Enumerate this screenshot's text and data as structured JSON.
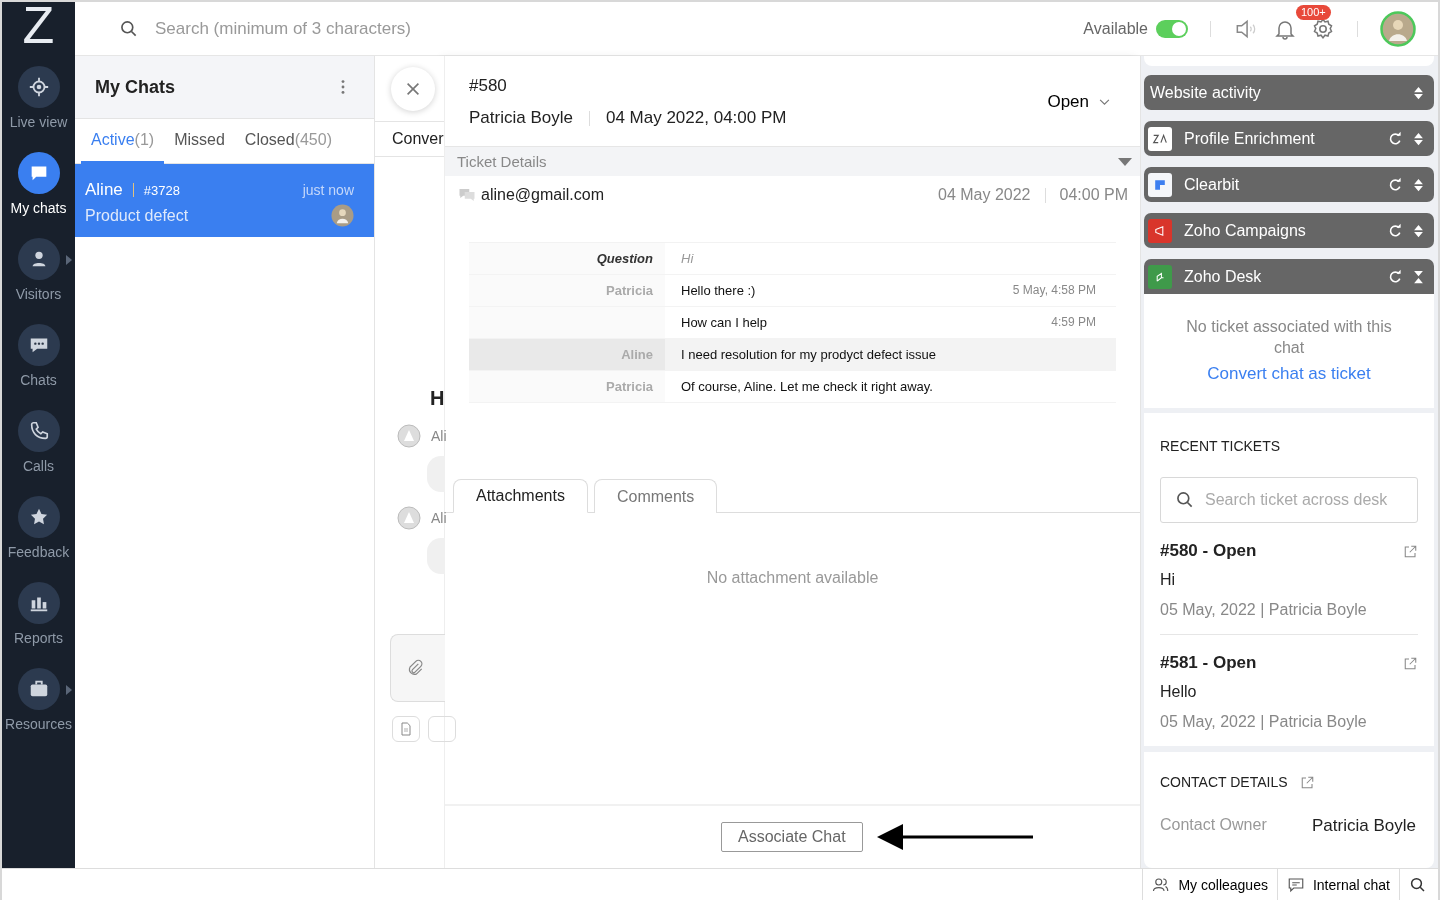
{
  "logo": "Z",
  "nav": [
    {
      "label": "Live view",
      "selected": false,
      "submenu": false
    },
    {
      "label": "My chats",
      "selected": true,
      "submenu": false
    },
    {
      "label": "Visitors",
      "selected": false,
      "submenu": true
    },
    {
      "label": "Chats",
      "selected": false,
      "submenu": false
    },
    {
      "label": "Calls",
      "selected": false,
      "submenu": false
    },
    {
      "label": "Feedback",
      "selected": false,
      "submenu": false
    },
    {
      "label": "Reports",
      "selected": false,
      "submenu": false
    },
    {
      "label": "Resources",
      "selected": false,
      "submenu": true
    }
  ],
  "search": {
    "placeholder": "Search (minimum of 3 characters)"
  },
  "status": {
    "label": "Available",
    "on": true
  },
  "notifications": {
    "badge": "100+"
  },
  "chat_list": {
    "title": "My Chats",
    "tabs": [
      {
        "label": "Active",
        "count": "(1)",
        "selected": true
      },
      {
        "label": "Missed",
        "selected": false
      },
      {
        "label": "Closed",
        "count": "(450)",
        "selected": false
      }
    ],
    "chats": [
      {
        "name": "Aline",
        "id": "#3728",
        "time": "just now",
        "subject": "Product defect",
        "selected": true
      }
    ]
  },
  "conversation": {
    "tab": "Conver",
    "heading": "H",
    "senders": [
      "Ali",
      "Ali"
    ]
  },
  "ticket": {
    "number": "#580",
    "contact": "Patricia Boyle",
    "datetime": "04 May 2022, 04:00 PM",
    "status": "Open",
    "section": "Ticket Details",
    "expanded": true,
    "email": "aline@gmail.com",
    "date": "04 May 2022",
    "time": "04:00 PM",
    "thread": [
      {
        "kind": "question",
        "label": "Question",
        "text": "Hi",
        "highlighted": false
      },
      {
        "kind": "message",
        "label": "Patricia",
        "text": "Hello there :)",
        "time": "5 May, 4:58 PM",
        "highlighted": false
      },
      {
        "kind": "message",
        "text": "How can I help",
        "time": "4:59 PM",
        "highlighted": false
      },
      {
        "kind": "message",
        "label": "Aline",
        "text": "I need resolution for my prodyct defect issue",
        "highlighted": true
      },
      {
        "kind": "message",
        "label": "Patricia",
        "text": "Of course, Aline. Let me check it right away.",
        "highlighted": false
      }
    ],
    "tabs": [
      {
        "label": "Attachments",
        "selected": true
      },
      {
        "label": "Comments",
        "selected": false
      }
    ],
    "empty": "No attachment available",
    "button": "Associate Chat"
  },
  "integrations": [
    {
      "name": "Website activity",
      "refresh": false,
      "expanded": false
    },
    {
      "name": "Profile Enrichment",
      "color": "#ffffff",
      "refresh": true,
      "expanded": false
    },
    {
      "name": "Clearbit",
      "color": "#f4f6f9",
      "refresh": true,
      "expanded": false
    },
    {
      "name": "Zoho Campaigns",
      "color": "#d9352b",
      "refresh": true,
      "expanded": false
    },
    {
      "name": "Zoho Desk",
      "color": "#3f9a4a",
      "refresh": true,
      "expanded": true
    }
  ],
  "desk": {
    "message": "No ticket associated with this chat",
    "link": "Convert chat as ticket"
  },
  "recent_tickets": {
    "title": "RECENT TICKETS",
    "placeholder": "Search ticket across desk",
    "tickets": [
      {
        "title": "#580 - Open",
        "subject": "Hi",
        "meta": "05 May, 2022 | Patricia Boyle"
      },
      {
        "title": "#581 - Open",
        "subject": "Hello",
        "meta": "05 May, 2022 | Patricia Boyle"
      }
    ]
  },
  "contact_details": {
    "title": "CONTACT DETAILS",
    "label": "Contact Owner",
    "value": "Patricia Boyle"
  },
  "bottom_bar": [
    "My colleagues",
    "Internal chat"
  ]
}
